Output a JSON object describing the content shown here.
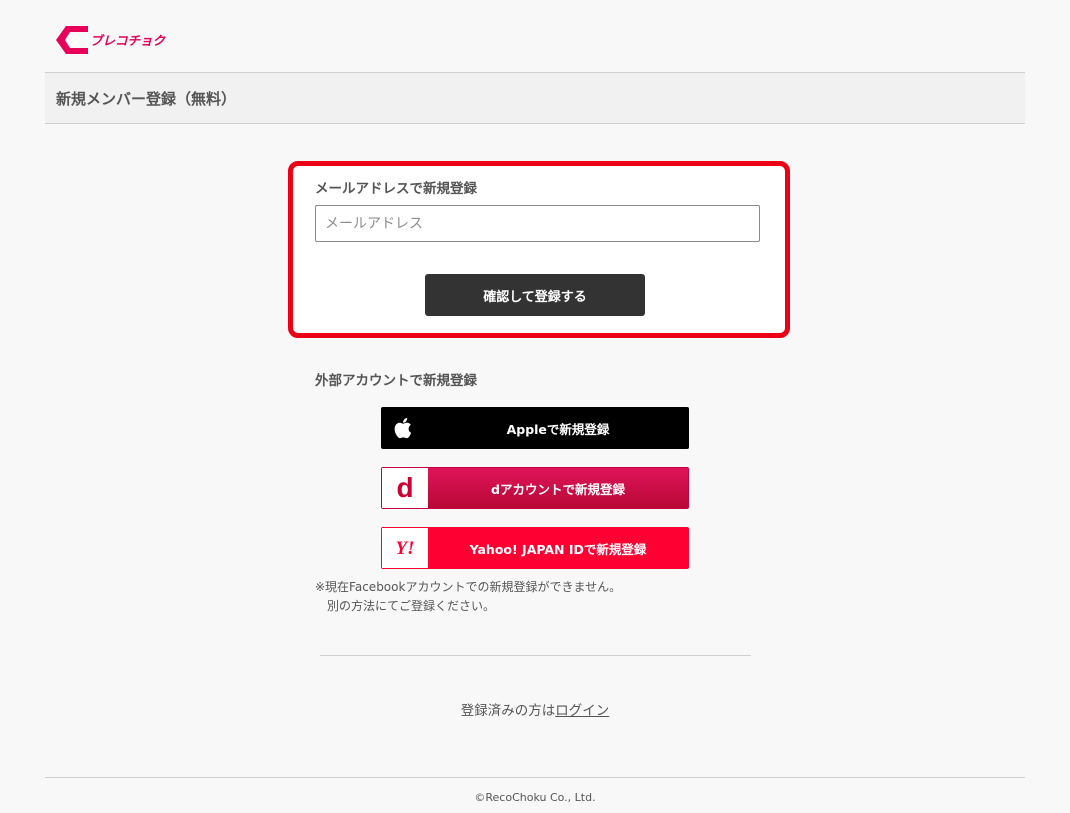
{
  "brand": {
    "logo_text": "クラブレコチョク",
    "color": "#e6005a"
  },
  "header": {
    "title": "新規メンバー登録（無料）"
  },
  "email_signup": {
    "heading": "メールアドレスで新規登録",
    "email_placeholder": "メールアドレス",
    "email_value": "",
    "submit_label": "確認して登録する",
    "highlight_color": "#ec0015"
  },
  "external_signup": {
    "heading": "外部アカウントで新規登録",
    "buttons": [
      {
        "label": "Appleで新規登録",
        "icon": "apple-icon"
      },
      {
        "label": "dアカウントで新規登録",
        "icon": "d-account-icon",
        "icon_text": "d"
      },
      {
        "label": "Yahoo! JAPAN IDで新規登録",
        "icon": "yahoo-icon",
        "icon_text": "Y!"
      }
    ],
    "note_line1": "※現在Facebookアカウントでの新規登録ができません。",
    "note_line2": "別の方法にてご登録ください。"
  },
  "login": {
    "prompt": "登録済みの方は",
    "link_label": "ログイン"
  },
  "footer": {
    "copyright": "©RecoChoku Co., Ltd."
  }
}
